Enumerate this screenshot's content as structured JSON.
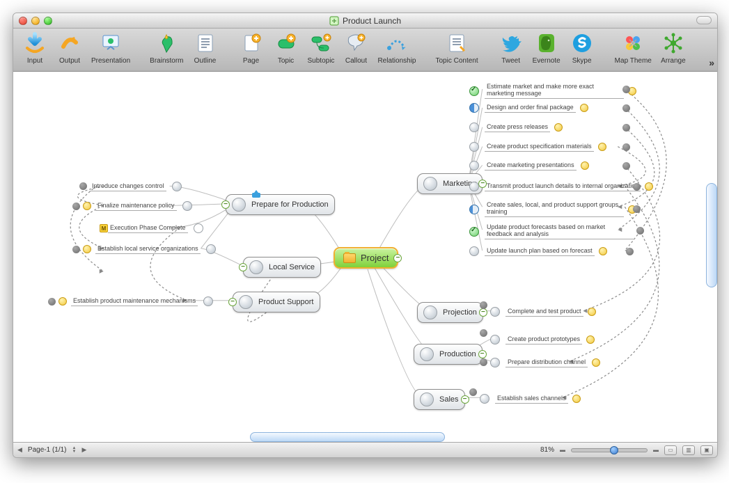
{
  "window": {
    "title": "Product Launch"
  },
  "toolbar": {
    "input": "Input",
    "output": "Output",
    "presentation": "Presentation",
    "brainstorm": "Brainstorm",
    "outline": "Outline",
    "page": "Page",
    "topic": "Topic",
    "subtopic": "Subtopic",
    "callout": "Callout",
    "relationship": "Relationship",
    "topiccontent": "Topic Content",
    "tweet": "Tweet",
    "evernote": "Evernote",
    "skype": "Skype",
    "maptheme": "Map Theme",
    "arrange": "Arrange"
  },
  "mindmap": {
    "root": "Project",
    "branches": {
      "prepare": "Prepare for Production",
      "localservice": "Local Service",
      "productsupport": "Product Support",
      "marketing": "Marketing",
      "projection": "Projection",
      "production": "Production",
      "sales": "Sales"
    },
    "leaves": {
      "l_introduce": "Introduce changes control",
      "l_finalize": "Finalize maintenance policy",
      "l_execution": "Execution Phase Complete",
      "l_establish_sv": "Establish local service organizations",
      "l_establish_pm": "Establish product maintenance mechanisms",
      "m_estimate": "Estimate market and make more exact marketing message",
      "m_design": "Design and order final package",
      "m_press": "Create press releases",
      "m_spec": "Create product specification materials",
      "m_presentations": "Create marketing presentations",
      "m_transmit": "Transmit product launch details to internal organization",
      "m_training": "Create sales, local, and product support groups training",
      "m_forecasts": "Update product forecasts based on market feedback and analysis",
      "m_launchplan": "Update launch plan based on forecast",
      "pj_complete": "Complete and test product",
      "pr_proto": "Create product prototypes",
      "pr_dist": "Prepare distribution channel",
      "s_channels": "Establish sales channels"
    }
  },
  "status": {
    "page": "Page-1 (1/1)",
    "zoom": "81%"
  }
}
